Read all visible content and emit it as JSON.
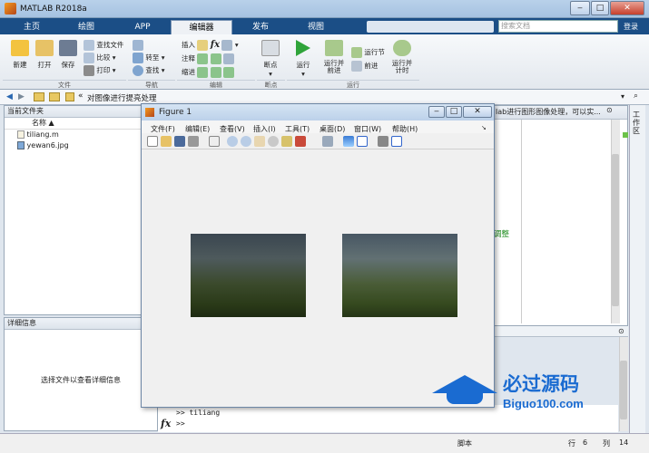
{
  "app": {
    "title": "MATLAB R2018a"
  },
  "tabs": [
    {
      "label": "主页"
    },
    {
      "label": "绘图"
    },
    {
      "label": "APP"
    },
    {
      "label": "编辑器"
    },
    {
      "label": "发布"
    },
    {
      "label": "视图"
    }
  ],
  "search": {
    "placeholder": "搜索文档",
    "login": "登录"
  },
  "ribbon": {
    "file_group": {
      "new": "新建",
      "open": "打开",
      "save": "保存",
      "find_file": "查找文件",
      "compare": "比较",
      "print": "打印",
      "group": "文件"
    },
    "nav_group": {
      "goto": "转至",
      "find": "查找",
      "group": "导航"
    },
    "edit_group": {
      "insert": "插入",
      "comment": "注释",
      "indent": "缩进",
      "fx": "fx",
      "group": "编辑"
    },
    "breakpoint_group": {
      "breakpoints": "断点",
      "group": "断点"
    },
    "run_group": {
      "run": "运行",
      "run_advance": "运行并\n前进",
      "run_section": "运行节",
      "advance": "前进",
      "run_time": "运行并\n计时",
      "group": "运行"
    }
  },
  "address": {
    "path": "对图像进行提亮处理"
  },
  "file_panel": {
    "title": "当前文件夹",
    "col_name": "名称 ▲",
    "files": [
      "tiliang.m",
      "yewan6.jpg"
    ]
  },
  "detail_panel": {
    "title": "详细信息",
    "msg": "选择文件以查看详细信息"
  },
  "editor": {
    "snippet": "lab进行图形图像处理，可以实...",
    "green_text": "调整"
  },
  "figure": {
    "title": "Figure 1",
    "menu": [
      "文件(F)",
      "编辑(E)",
      "查看(V)",
      "插入(I)",
      "工具(T)",
      "桌面(D)",
      "窗口(W)",
      "帮助(H)"
    ]
  },
  "command": {
    "line1": ">> tiliang",
    "prompt": ">>",
    "fx": "fx"
  },
  "status": {
    "script": "脚本",
    "row_label": "行",
    "row": "6",
    "col_label": "列",
    "col": "14"
  },
  "sidebar": {
    "label": "工作区"
  },
  "watermark": {
    "text1": "必过源码",
    "text2": "Biguo100.com"
  }
}
